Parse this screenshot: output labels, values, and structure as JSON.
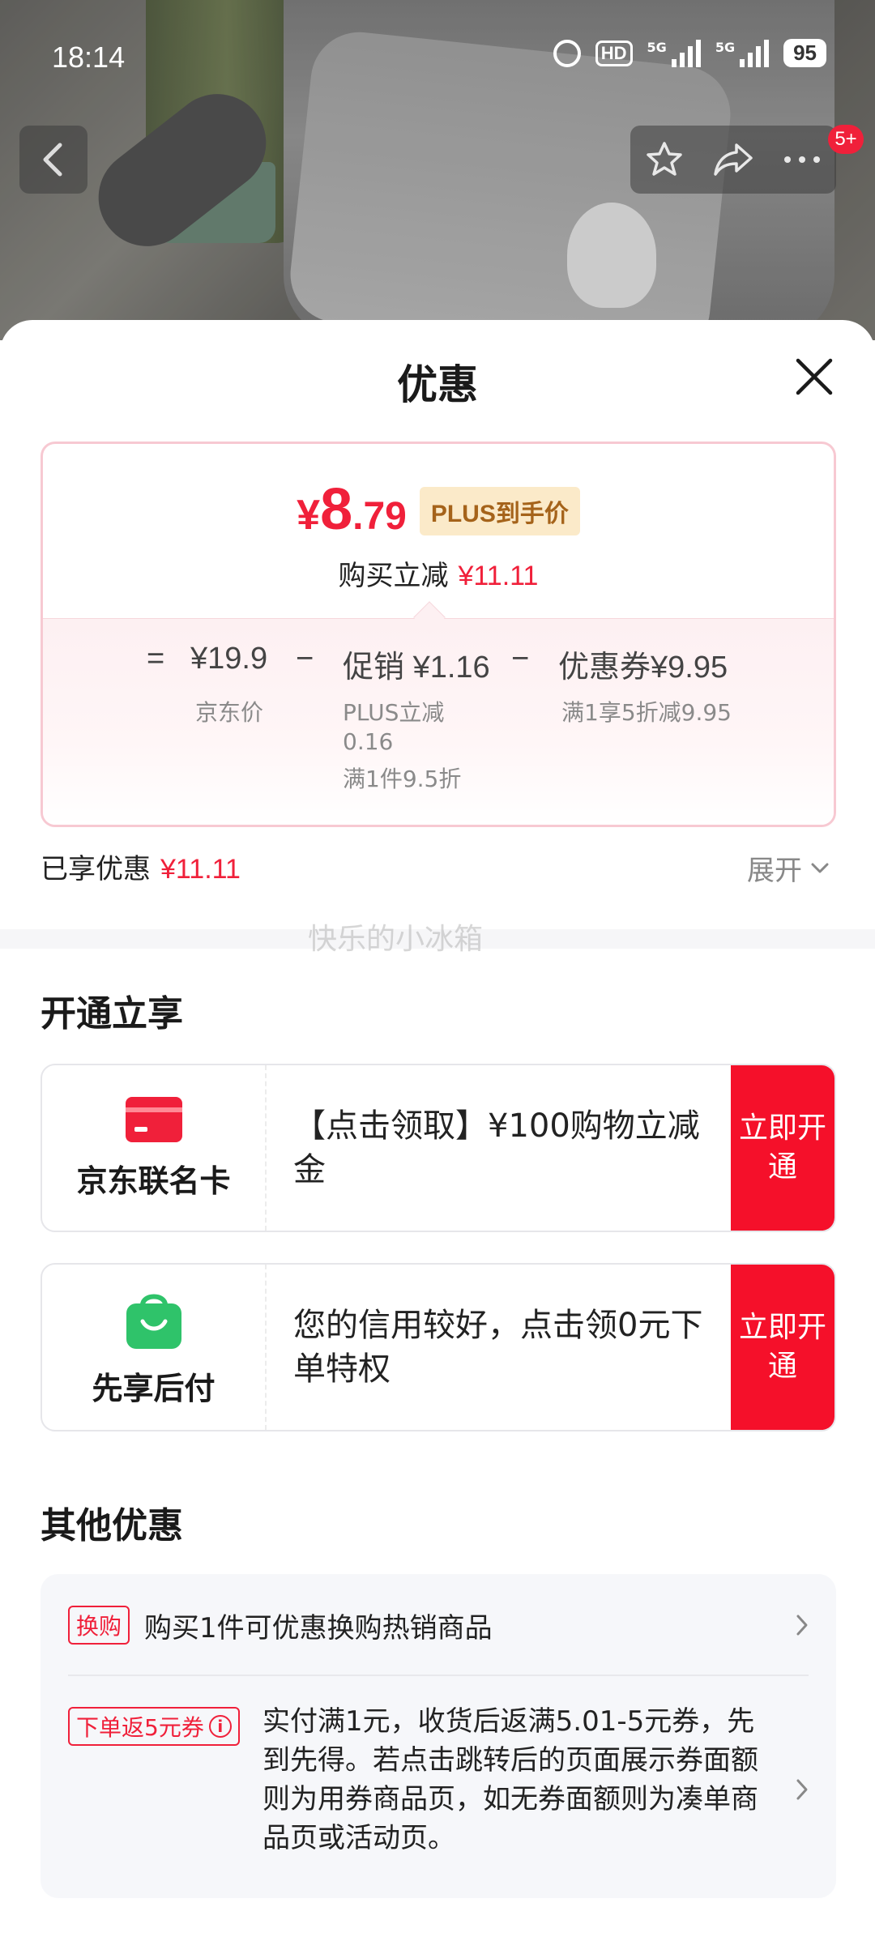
{
  "status_bar": {
    "time": "18:14",
    "hd_label": "HD",
    "sim1_label": "5G",
    "sim2_label": "5G",
    "battery": "95"
  },
  "top_nav": {
    "cart_badge": "5+"
  },
  "sheet": {
    "title": "优惠"
  },
  "price_card": {
    "currency": "¥",
    "final_price_int": "8",
    "final_price_dec": ".79",
    "plus_tag": "PLUS到手价",
    "reduce_label": "购买立减",
    "reduce_amount": "¥11.11",
    "equals": "=",
    "jd_price": "¥19.9",
    "jd_price_label": "京东价",
    "minus1": "−",
    "promo_label": "促销",
    "promo_amount": "¥1.16",
    "promo_detail_1": "PLUS立减",
    "promo_detail_2": "0.16",
    "promo_detail_3": "满1件9.5折",
    "minus2": "−",
    "coupon_label": "优惠券",
    "coupon_amount": "¥9.95",
    "coupon_detail": "满1享5折减9.95"
  },
  "summary": {
    "enjoyed_label": "已享优惠",
    "enjoyed_amount": "¥11.11",
    "expand_label": "展开"
  },
  "watermark": "快乐的小冰箱",
  "open_section": {
    "title": "开通立享",
    "cards": [
      {
        "name": "京东联名卡",
        "icon": "credit-card-icon",
        "text": "【点击领取】¥100购物立减金",
        "button": "立即开通"
      },
      {
        "name": "先享后付",
        "icon": "shopping-bag-icon",
        "text": "您的信用较好，点击领0元下单特权",
        "button": "立即开通"
      }
    ]
  },
  "other_section": {
    "title": "其他优惠",
    "offers": [
      {
        "tag": "换购",
        "text": "购买1件可优惠换购热销商品"
      },
      {
        "tag": "下单返5元券",
        "text": "实付满1元，收货后返满5.01-5元券，先到先得。若点击跳转后的页面展示券面额则为用券商品页，如无券面额则为凑单商品页或活动页。"
      }
    ]
  },
  "colors": {
    "accent_red": "#f0203a",
    "plus_gold_bg": "#fbeac9",
    "plus_gold_text": "#a5631a",
    "green": "#2fc36a"
  }
}
